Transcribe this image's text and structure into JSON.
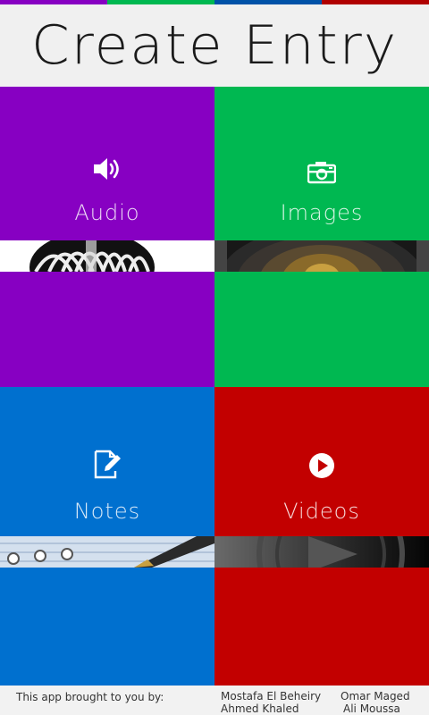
{
  "header": {
    "title": "Create Entry"
  },
  "colors": {
    "purple": "#8700c2",
    "green": "#00b851",
    "blue": "#0070cf",
    "red": "#c20000"
  },
  "tiles": [
    {
      "label": "Audio",
      "icon": "speaker-icon",
      "strip": "microphone-image"
    },
    {
      "label": "Images",
      "icon": "camera-icon",
      "strip": "camera-lens-image"
    },
    {
      "label": "Notes",
      "icon": "edit-note-icon",
      "strip": "pen-notebook-image"
    },
    {
      "label": "Videos",
      "icon": "play-icon",
      "strip": "play-button-image"
    }
  ],
  "footer": {
    "intro": "This app brought to you by:",
    "names": [
      "Mostafa El Beheiry",
      "Omar Maged",
      "Ahmed Khaled",
      "Ali Moussa"
    ]
  }
}
